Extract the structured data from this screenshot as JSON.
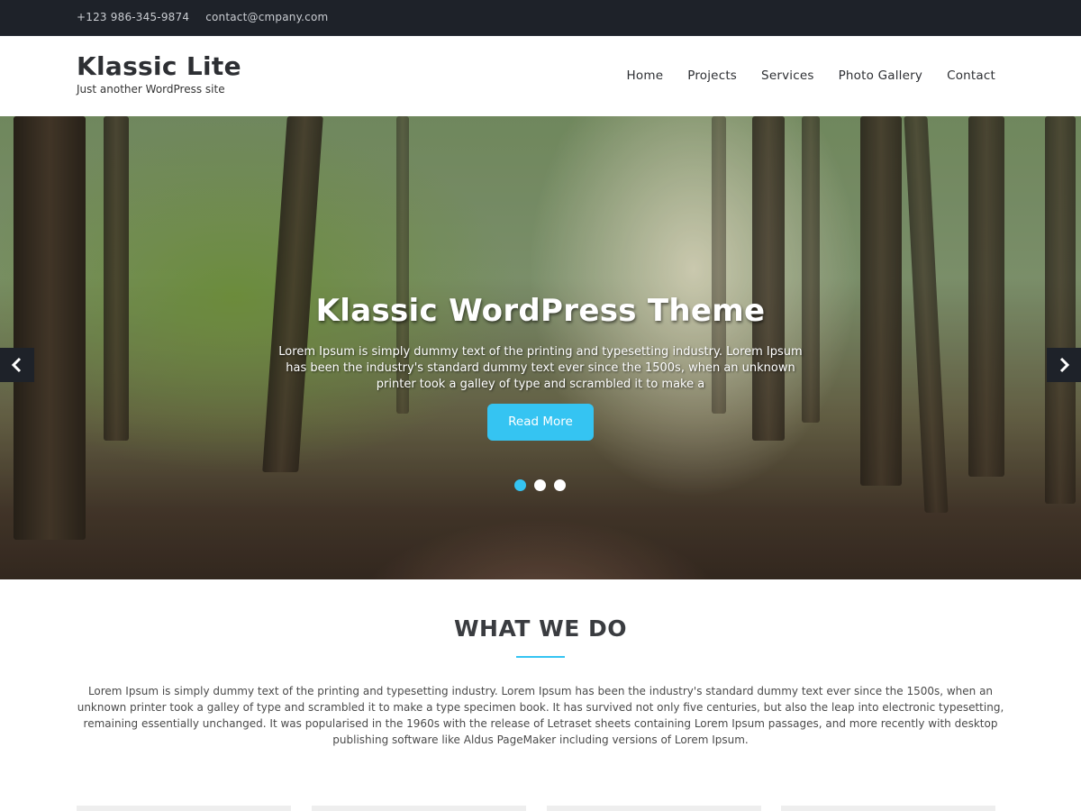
{
  "topbar": {
    "phone": "+123 986-345-9874",
    "email": "contact@cmpany.com"
  },
  "header": {
    "site_title": "Klassic Lite",
    "tagline": "Just another WordPress site",
    "nav": [
      "Home",
      "Projects",
      "Services",
      "Photo Gallery",
      "Contact"
    ]
  },
  "hero": {
    "title": "Klassic WordPress Theme",
    "text": "Lorem Ipsum is simply dummy text of the printing and typesetting industry. Lorem Ipsum has been the industry's standard dummy text ever since the 1500s, when an unknown printer took a galley of type and scrambled it to make a",
    "button_label": "Read More",
    "slides_count": 3,
    "active_slide": 1,
    "prev_icon": "chevron-left-icon",
    "next_icon": "chevron-right-icon"
  },
  "what_we_do": {
    "title": "WHAT WE DO",
    "text": "Lorem Ipsum is simply dummy text of the printing and typesetting industry. Lorem Ipsum has been the industry's standard dummy text ever since the 1500s, when an unknown printer took a galley of type and scrambled it to make a type specimen book. It has survived not only five centuries, but also the leap into electronic typesetting, remaining essentially unchanged. It was popularised in the 1960s with the release of Letraset sheets containing Lorem Ipsum passages, and more recently with desktop publishing software like Aldus PageMaker including versions of Lorem Ipsum."
  },
  "colors": {
    "accent": "#35c4f2",
    "topbar_bg": "#1e2229",
    "heading_text": "#3a3c40"
  }
}
